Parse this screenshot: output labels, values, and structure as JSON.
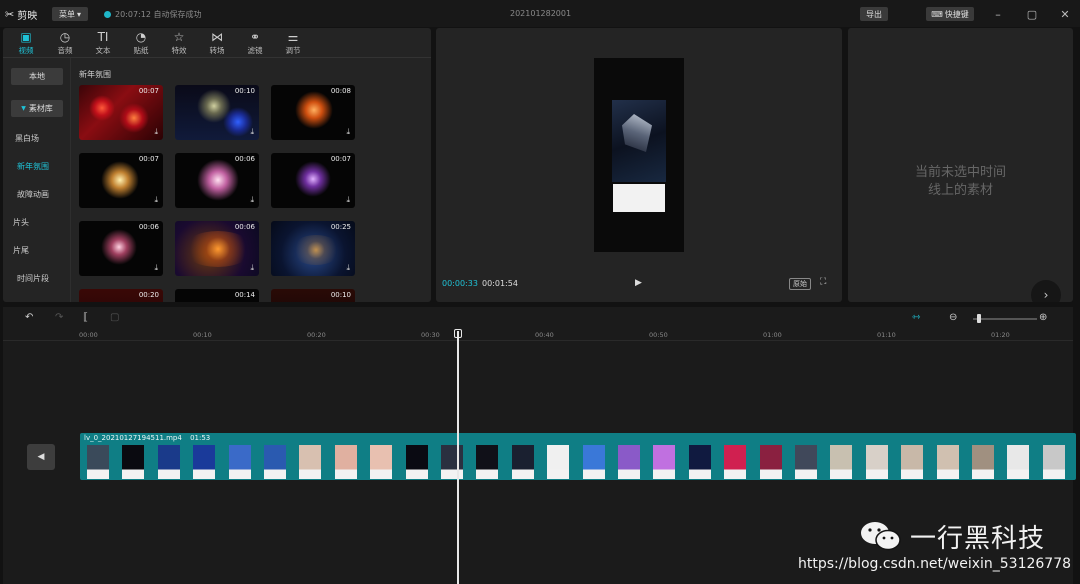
{
  "titlebar": {
    "app_name": "剪映",
    "menu_label": "菜单",
    "save_status": "20:07:12 自动保存成功",
    "project_title": "202101282001",
    "export_label": "导出",
    "shortcut_label": "快捷键"
  },
  "toolbar": {
    "tools": [
      {
        "label": "视频",
        "icon": "video-icon"
      },
      {
        "label": "音频",
        "icon": "audio-icon"
      },
      {
        "label": "文本",
        "icon": "text-icon",
        "glyph": "TI"
      },
      {
        "label": "贴纸",
        "icon": "sticker-icon"
      },
      {
        "label": "特效",
        "icon": "effects-icon"
      },
      {
        "label": "转场",
        "icon": "transition-icon"
      },
      {
        "label": "滤镜",
        "icon": "filter-icon"
      },
      {
        "label": "调节",
        "icon": "adjust-icon"
      }
    ]
  },
  "sidebar": {
    "items": [
      "本地",
      "素材库",
      "黑白场",
      "新年氛围",
      "故障动画",
      "片头",
      "片尾",
      "时间片段"
    ]
  },
  "library": {
    "section_title": "新年氛围",
    "thumbs": [
      {
        "duration": "00:07"
      },
      {
        "duration": "00:10"
      },
      {
        "duration": "00:08"
      },
      {
        "duration": "00:07"
      },
      {
        "duration": "00:06"
      },
      {
        "duration": "00:07"
      },
      {
        "duration": "00:06"
      },
      {
        "duration": "00:06"
      },
      {
        "duration": "00:25"
      },
      {
        "duration": "00:20"
      },
      {
        "duration": "00:14"
      },
      {
        "duration": "00:10"
      }
    ]
  },
  "preview": {
    "current_time": "00:00:33",
    "total_time": "00:01:54",
    "original_label": "原始"
  },
  "properties": {
    "empty_line1": "当前未选中时间",
    "empty_line2": "线上的素材"
  },
  "timeline": {
    "ruler": [
      "00:00",
      "00:10",
      "00:20",
      "00:30",
      "00:40",
      "00:50",
      "01:00",
      "01:10",
      "01:20"
    ],
    "clip_name": "lv_0_20210127194511.mp4",
    "clip_duration": "01:53"
  },
  "watermark": {
    "brand": "一行黑科技",
    "url": "https://blog.csdn.net/weixin_53126778"
  },
  "colors": {
    "accent": "#1fc2d6",
    "clip": "#0f7e85"
  }
}
